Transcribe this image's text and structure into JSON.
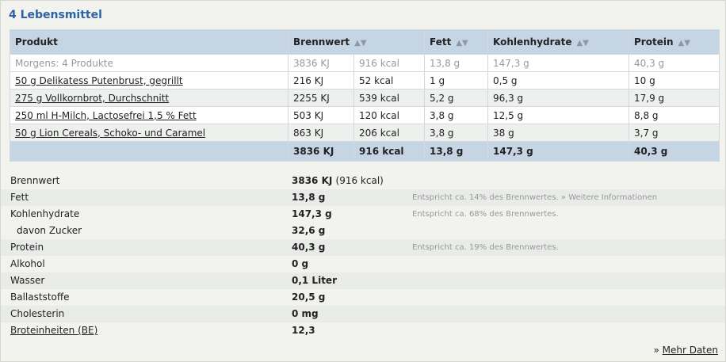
{
  "heading": "4 Lebensmittel",
  "sort_icon": "sort-arrows-icon",
  "columns": {
    "product": "Produkt",
    "energy": "Brennwert",
    "fat": "Fett",
    "carbs": "Kohlenhydrate",
    "protein": "Protein"
  },
  "group_row": {
    "label": "Morgens: 4 Produkte",
    "kj": "3836 KJ",
    "kcal": "916 kcal",
    "fat": "13,8 g",
    "carbs": "147,3 g",
    "protein": "40,3 g"
  },
  "rows": [
    {
      "name": "50 g Delikatess Putenbrust, gegrillt",
      "kj": "216 KJ",
      "kcal": "52 kcal",
      "fat": "1 g",
      "carbs": "0,5 g",
      "protein": "10 g"
    },
    {
      "name": "275 g Vollkornbrot, Durchschnitt",
      "kj": "2255 KJ",
      "kcal": "539 kcal",
      "fat": "5,2 g",
      "carbs": "96,3 g",
      "protein": "17,9 g"
    },
    {
      "name": "250 ml H-Milch, Lactosefrei 1,5 % Fett",
      "kj": "503 KJ",
      "kcal": "120 kcal",
      "fat": "3,8 g",
      "carbs": "12,5 g",
      "protein": "8,8 g"
    },
    {
      "name": "50 g Lion Cereals, Schoko- und Caramel",
      "kj": "863 KJ",
      "kcal": "206 kcal",
      "fat": "3,8 g",
      "carbs": "38 g",
      "protein": "3,7 g"
    }
  ],
  "totals": {
    "kj": "3836 KJ",
    "kcal": "916 kcal",
    "fat": "13,8 g",
    "carbs": "147,3 g",
    "protein": "40,3 g"
  },
  "summary": {
    "energy": {
      "label": "Brennwert",
      "value": "3836 KJ",
      "extra": "(916 kcal)"
    },
    "fat": {
      "label": "Fett",
      "value": "13,8 g",
      "note": "Entspricht ca. 14% des Brennwertes.",
      "link": "» Weitere Informationen"
    },
    "carbs": {
      "label": "Kohlenhydrate",
      "value": "147,3 g",
      "note": "Entspricht ca. 68% des Brennwertes."
    },
    "sugar": {
      "label": "davon Zucker",
      "value": "32,6 g"
    },
    "protein": {
      "label": "Protein",
      "value": "40,3 g",
      "note": "Entspricht ca. 19% des Brennwertes."
    },
    "alcohol": {
      "label": "Alkohol",
      "value": "0 g"
    },
    "water": {
      "label": "Wasser",
      "value": "0,1 Liter"
    },
    "fiber": {
      "label": "Ballaststoffe",
      "value": "20,5 g"
    },
    "cholesterol": {
      "label": "Cholesterin",
      "value": "0 mg"
    },
    "bread_units": {
      "label": "Broteinheiten (BE)",
      "value": "12,3"
    }
  },
  "more": {
    "prefix": "»",
    "label": "Mehr Daten"
  }
}
